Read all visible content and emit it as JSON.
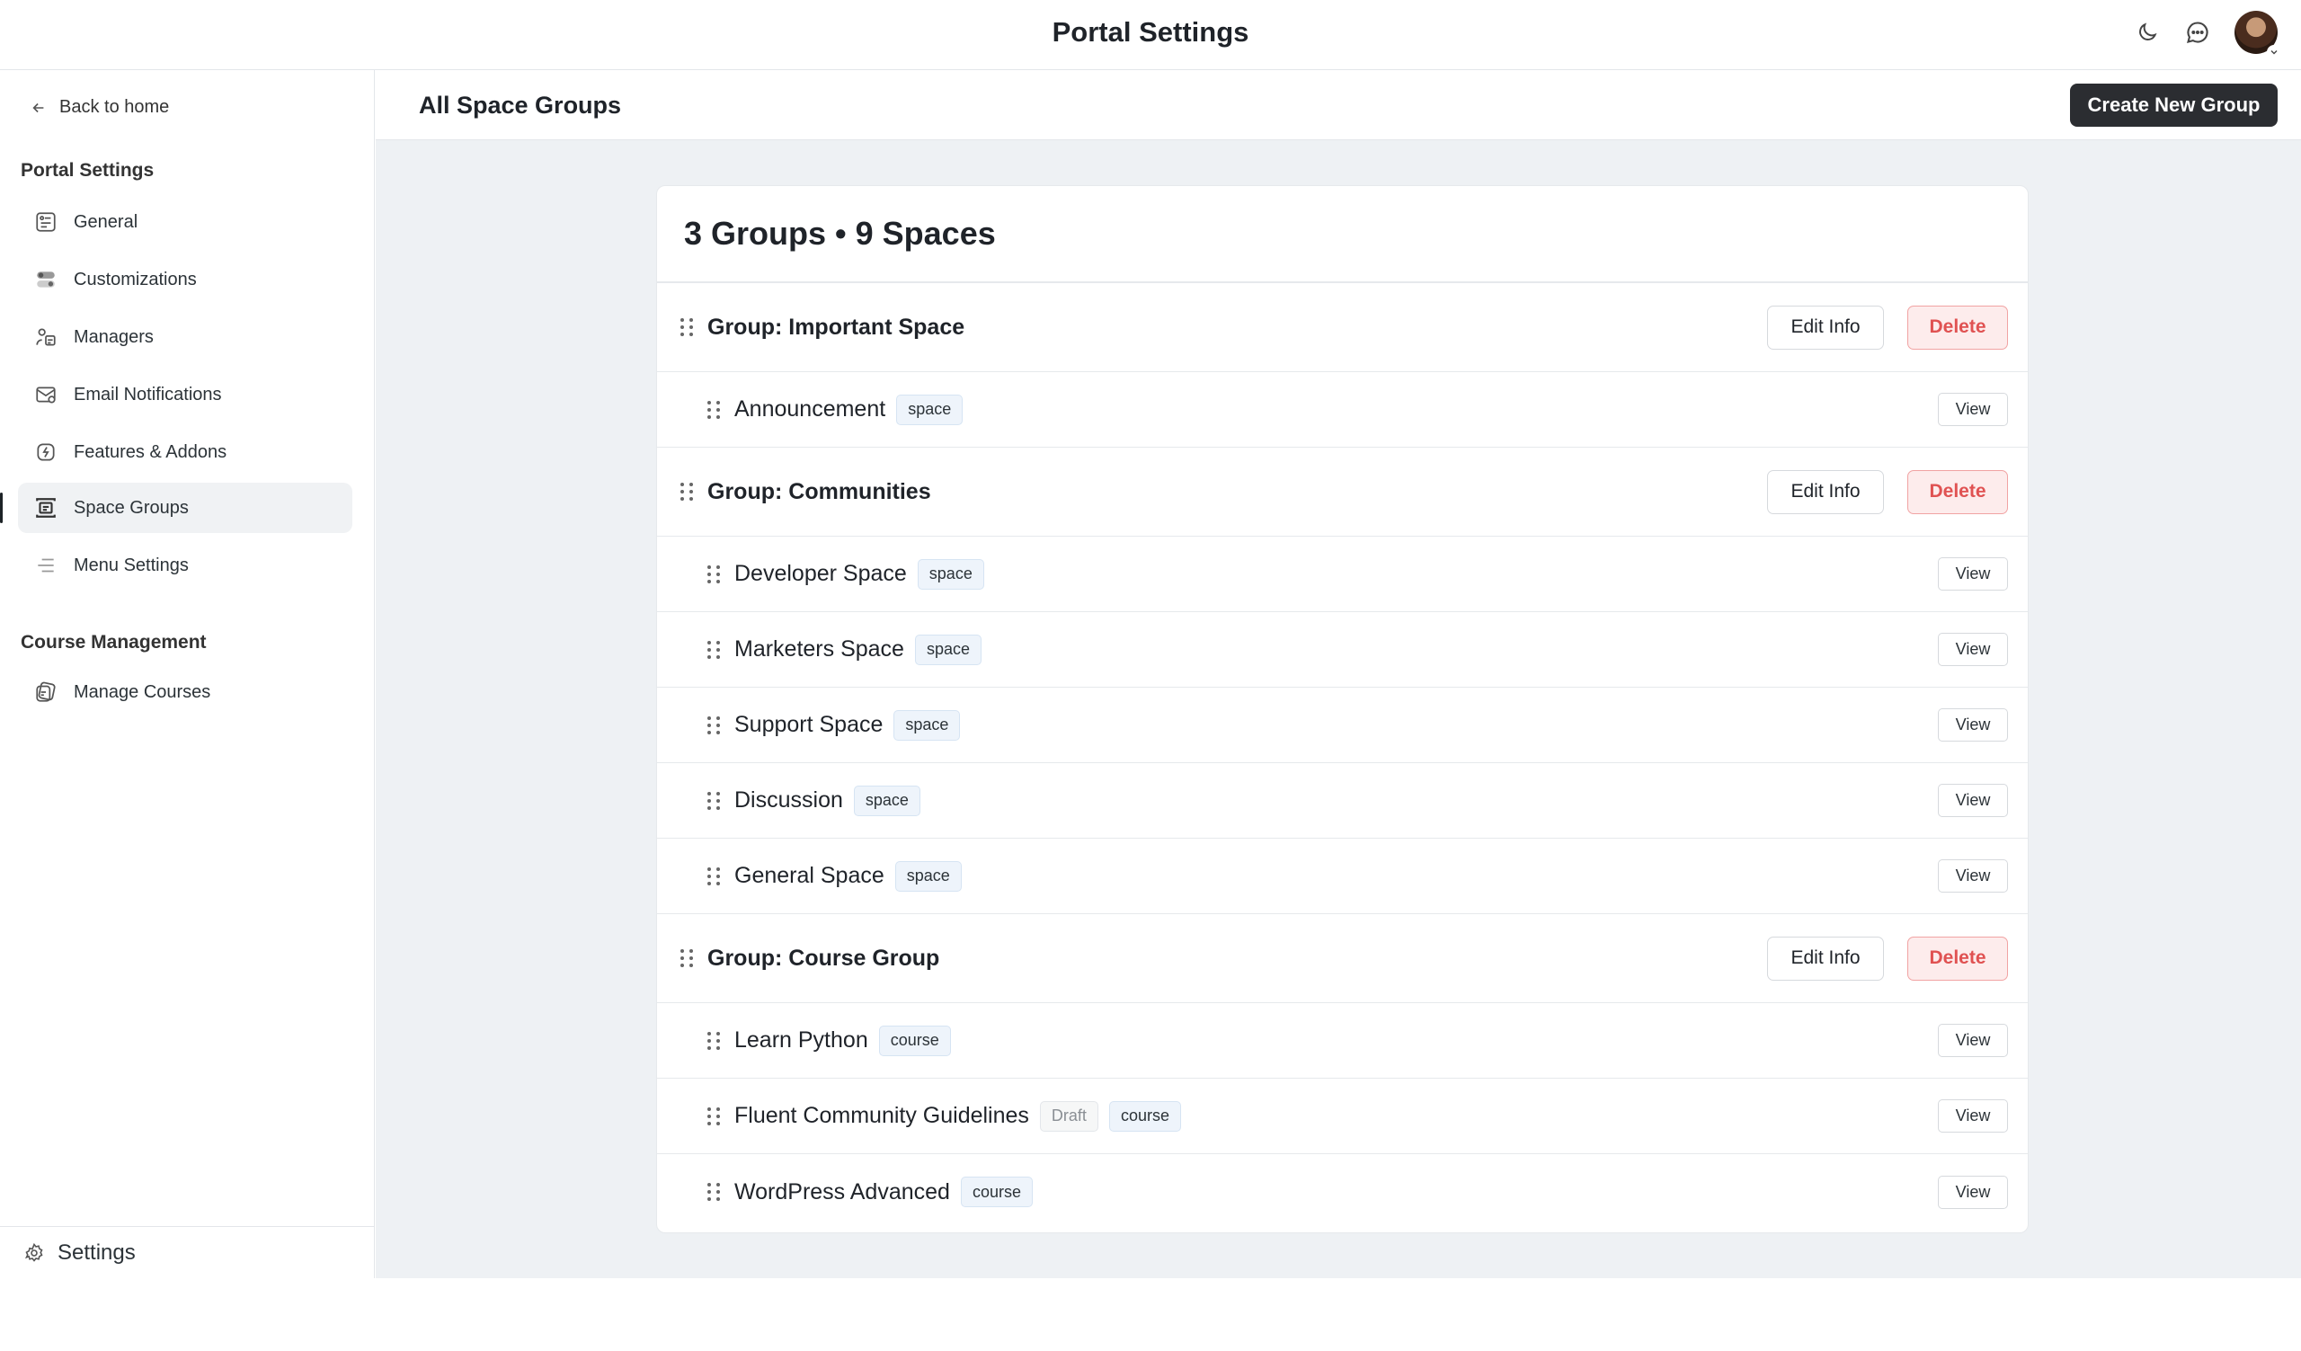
{
  "header": {
    "title": "Portal Settings"
  },
  "sidebar": {
    "back_label": "Back to home",
    "portal_section": "Portal Settings",
    "items": [
      {
        "label": "General",
        "icon": "general-settings-icon"
      },
      {
        "label": "Customizations",
        "icon": "toggles-icon"
      },
      {
        "label": "Managers",
        "icon": "managers-icon"
      },
      {
        "label": "Email Notifications",
        "icon": "email-icon"
      },
      {
        "label": "Features & Addons",
        "icon": "features-icon"
      },
      {
        "label": "Space Groups",
        "icon": "space-groups-icon",
        "active": true
      },
      {
        "label": "Menu Settings",
        "icon": "menu-lines-icon"
      }
    ],
    "course_section": "Course Management",
    "course_items": [
      {
        "label": "Manage Courses",
        "icon": "courses-icon"
      }
    ],
    "settings_label": "Settings"
  },
  "main": {
    "title": "All Space Groups",
    "create_button": "Create New Group",
    "summary": "3 Groups • 9 Spaces",
    "edit_label": "Edit Info",
    "delete_label": "Delete",
    "view_label": "View",
    "groups": [
      {
        "name": "Group: Important Space",
        "items": [
          {
            "name": "Announcement",
            "badges": [
              "space"
            ]
          }
        ]
      },
      {
        "name": "Group: Communities",
        "items": [
          {
            "name": "Developer Space",
            "badges": [
              "space"
            ]
          },
          {
            "name": "Marketers Space",
            "badges": [
              "space"
            ]
          },
          {
            "name": "Support Space",
            "badges": [
              "space"
            ]
          },
          {
            "name": "Discussion",
            "badges": [
              "space"
            ]
          },
          {
            "name": "General Space",
            "badges": [
              "space"
            ]
          }
        ]
      },
      {
        "name": "Group: Course Group",
        "items": [
          {
            "name": "Learn Python",
            "badges": [
              "course"
            ]
          },
          {
            "name": "Fluent Community Guidelines",
            "badges": [
              "Draft",
              "course"
            ]
          },
          {
            "name": "WordPress Advanced",
            "badges": [
              "course"
            ]
          }
        ]
      }
    ]
  }
}
